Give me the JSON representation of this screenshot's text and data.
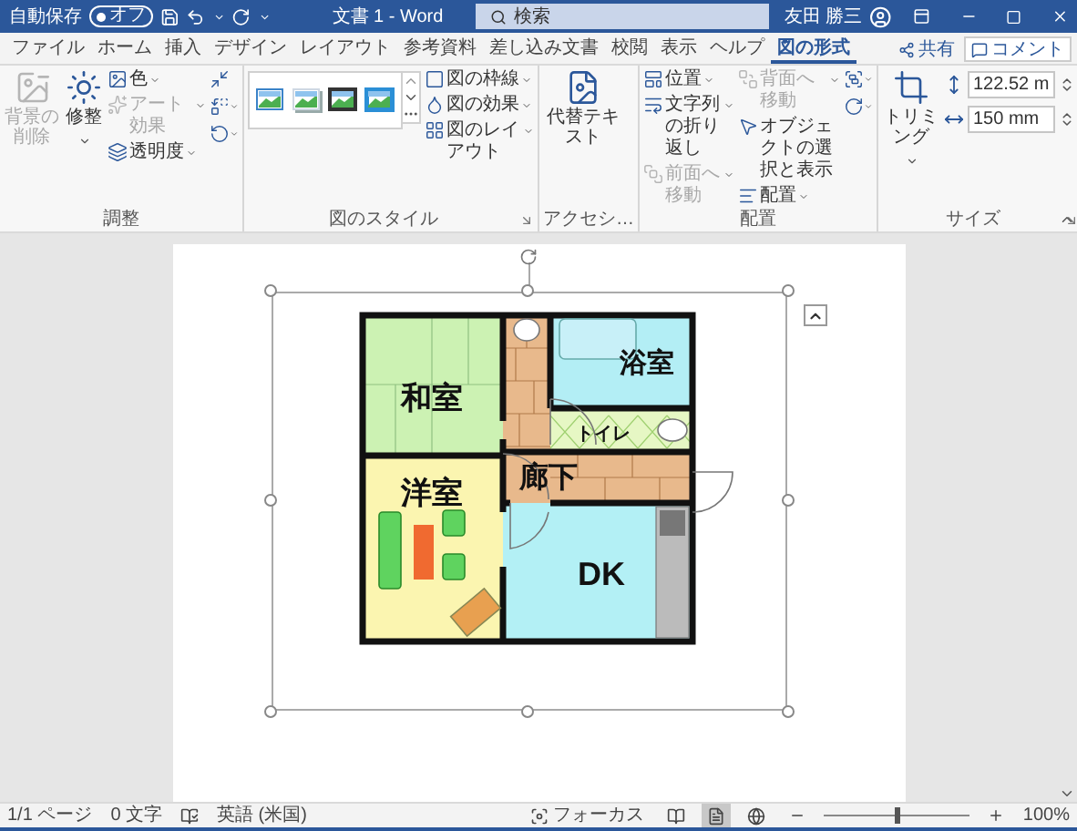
{
  "title_bar": {
    "autosave_label": "自動保存",
    "autosave_state": "オフ",
    "autosave_on": false,
    "document_title": "文書 1 - Word",
    "search_placeholder": "検索",
    "user_name": "友田 勝三"
  },
  "tabs": [
    {
      "label": "ファイル",
      "selected": false
    },
    {
      "label": "ホーム",
      "selected": false
    },
    {
      "label": "挿入",
      "selected": false
    },
    {
      "label": "デザイン",
      "selected": false
    },
    {
      "label": "レイアウト",
      "selected": false
    },
    {
      "label": "参考資料",
      "selected": false
    },
    {
      "label": "差し込み文書",
      "selected": false
    },
    {
      "label": "校閲",
      "selected": false
    },
    {
      "label": "表示",
      "selected": false
    },
    {
      "label": "ヘルプ",
      "selected": false
    },
    {
      "label": "図の形式",
      "selected": true
    }
  ],
  "share_button": "共有",
  "comment_button": "コメント",
  "ribbon": {
    "groups": [
      {
        "label": "調整",
        "columns": [
          {
            "kind": "large",
            "items": [
              {
                "label": "背景の削除",
                "disabled": true,
                "dropdown": false
              }
            ]
          },
          {
            "kind": "large",
            "items": [
              {
                "label": "修整",
                "disabled": false,
                "dropdown": true
              }
            ]
          },
          {
            "kind": "small",
            "items": [
              {
                "label": "色",
                "disabled": false,
                "dropdown": true
              },
              {
                "label": "アート効果",
                "disabled": true,
                "dropdown": true
              },
              {
                "label": "透明度",
                "disabled": false,
                "dropdown": true
              }
            ]
          },
          {
            "kind": "icons",
            "items": [
              {
                "disabled": false,
                "dropdown": false
              },
              {
                "disabled": false,
                "dropdown": true
              },
              {
                "disabled": false,
                "dropdown": true
              }
            ]
          }
        ]
      },
      {
        "label": "図のスタイル",
        "launcher": true,
        "columns": [
          {
            "kind": "gallery"
          },
          {
            "kind": "small",
            "items": [
              {
                "label": "図の枠線",
                "disabled": false,
                "dropdown": true
              },
              {
                "label": "図の効果",
                "disabled": false,
                "dropdown": true
              },
              {
                "label": "図のレイアウト",
                "disabled": false,
                "dropdown": true
              }
            ]
          }
        ]
      },
      {
        "label": "アクセシ…",
        "columns": [
          {
            "kind": "large",
            "items": [
              {
                "label": "代替テキスト",
                "disabled": false,
                "dropdown": false
              }
            ]
          }
        ]
      },
      {
        "label": "配置",
        "columns": [
          {
            "kind": "small",
            "items": [
              {
                "label": "位置",
                "disabled": false,
                "dropdown": true
              },
              {
                "label": "文字列の折り返し",
                "disabled": false,
                "dropdown": true
              },
              {
                "label": "前面へ移動",
                "disabled": true,
                "dropdown": true
              }
            ]
          },
          {
            "kind": "small",
            "items": [
              {
                "label": "背面へ移動",
                "disabled": true,
                "dropdown": true
              },
              {
                "label": "オブジェクトの選択と表示",
                "disabled": false,
                "dropdown": false
              },
              {
                "label": "配置",
                "disabled": false,
                "dropdown": true
              }
            ]
          },
          {
            "kind": "icons",
            "items": [
              {
                "disabled": false,
                "dropdown": true
              },
              {
                "disabled": false,
                "dropdown": true
              }
            ]
          }
        ]
      },
      {
        "label": "サイズ",
        "launcher": true,
        "columns": [
          {
            "kind": "large",
            "items": [
              {
                "label": "トリミング",
                "disabled": false,
                "dropdown": true
              }
            ]
          },
          {
            "kind": "size",
            "items": [
              {
                "value": "122.52 m"
              },
              {
                "value": "150 mm"
              }
            ]
          }
        ]
      }
    ]
  },
  "floor_plan": {
    "rooms": [
      {
        "label": "和室",
        "color": "#ccf2b3"
      },
      {
        "label": "浴室",
        "color": "#b3eef5"
      },
      {
        "label": "トイレ",
        "color": "#e6f7c4"
      },
      {
        "label": "廊下",
        "color": "#e8b98c"
      },
      {
        "label": "洋室",
        "color": "#fbf5b0"
      },
      {
        "label": "DK",
        "color": "#b3f0f5"
      }
    ]
  },
  "status_bar": {
    "page": "1/1 ページ",
    "words": "0 文字",
    "language": "英語 (米国)",
    "focus": "フォーカス",
    "views": [
      {
        "selected": false
      },
      {
        "selected": true
      },
      {
        "selected": false
      }
    ],
    "zoom": {
      "level": 0.5,
      "reading": "100%"
    }
  }
}
